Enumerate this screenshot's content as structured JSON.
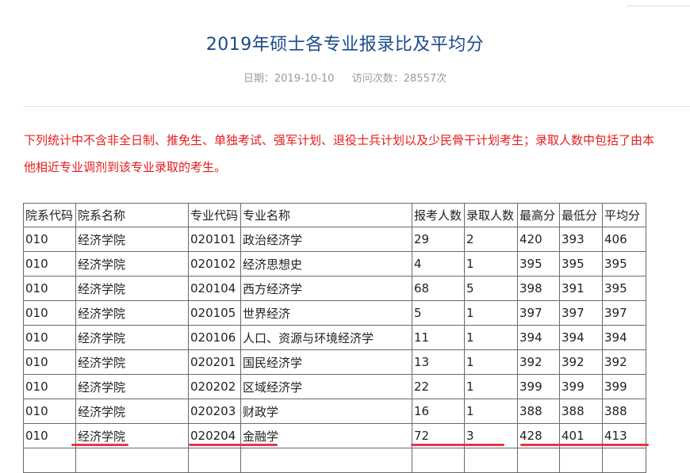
{
  "page": {
    "title": "2019年硕士各专业报录比及平均分",
    "date_label": "日期：",
    "date": "2019-10-10",
    "visits_label": "访问次数：",
    "visits": "28557",
    "visits_unit": "次"
  },
  "notice": {
    "line1": "下列统计中不含非全日制、推免生、单独考试、强军计划、退役士兵计划以及少民骨干计划考生；录取人数中包括了由本",
    "line2": "他相近专业调剂到该专业录取的考生。"
  },
  "table": {
    "headers": [
      "院系代码",
      "院系名称",
      "专业代码",
      "专业名称",
      "报考人数",
      "录取人数",
      "最高分",
      "最低分",
      "平均分"
    ],
    "rows": [
      [
        "010",
        "经济学院",
        "020101",
        "政治经济学",
        "29",
        "2",
        "420",
        "393",
        "406"
      ],
      [
        "010",
        "经济学院",
        "020102",
        "经济思想史",
        "4",
        "1",
        "395",
        "395",
        "395"
      ],
      [
        "010",
        "经济学院",
        "020104",
        "西方经济学",
        "68",
        "5",
        "398",
        "391",
        "395"
      ],
      [
        "010",
        "经济学院",
        "020105",
        "世界经济",
        "5",
        "1",
        "397",
        "397",
        "397"
      ],
      [
        "010",
        "经济学院",
        "020106",
        "人口、资源与环境经济学",
        "11",
        "1",
        "394",
        "394",
        "394"
      ],
      [
        "010",
        "经济学院",
        "020201",
        "国民经济学",
        "13",
        "1",
        "392",
        "392",
        "392"
      ],
      [
        "010",
        "经济学院",
        "020202",
        "区域经济学",
        "22",
        "1",
        "399",
        "399",
        "399"
      ],
      [
        "010",
        "经济学院",
        "020203",
        "财政学",
        "16",
        "1",
        "388",
        "388",
        "388"
      ],
      [
        "010",
        "经济学院",
        "020204",
        "金融学",
        "72",
        "3",
        "428",
        "401",
        "413"
      ],
      [
        "",
        "",
        "",
        "",
        "",
        "",
        "",
        "",
        ""
      ]
    ]
  }
}
